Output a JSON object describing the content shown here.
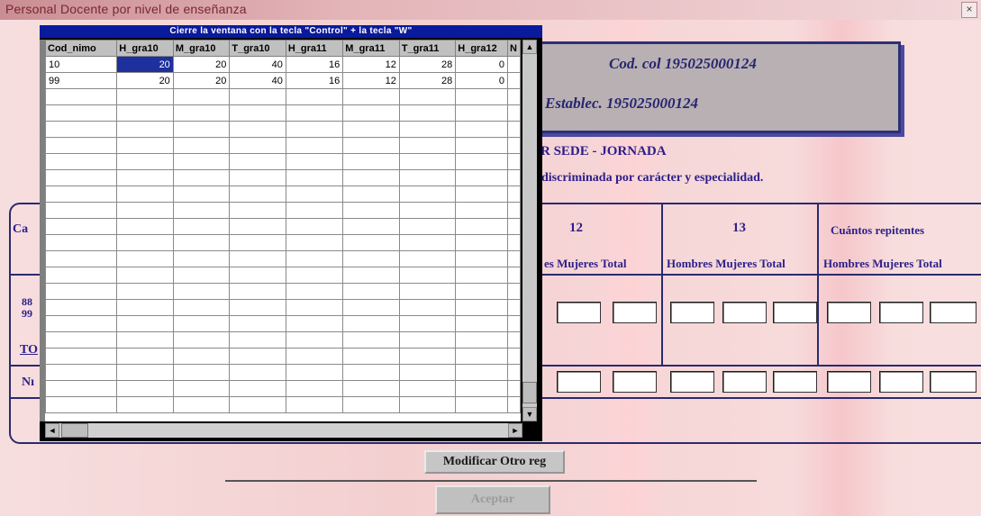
{
  "window": {
    "title": "Personal Docente por nivel de enseñanza",
    "close_glyph": "×"
  },
  "info": {
    "cod_col": "Cod. col 195025000124",
    "establec": "Establec.  195025000124"
  },
  "section": {
    "sede_heading": "R SEDE - JORNADA",
    "discriminada": "discriminada por carácter y especialidad."
  },
  "table": {
    "left_header_partial": "Ca",
    "left_rows_partial": [
      "88",
      "99"
    ],
    "total_partial": "TO",
    "num_partial": "Nı",
    "groups": [
      {
        "title": "12",
        "sub": "es  Mujeres Total"
      },
      {
        "title": "13",
        "sub": "Hombres Mujeres Total"
      },
      {
        "title": "Cuántos repitentes",
        "sub": "Hombres Mujeres Total"
      }
    ]
  },
  "datasheet": {
    "title": "Cierre la ventana con la tecla \"Control\" + la tecla \"W\"",
    "columns": [
      "Cod_nimo",
      "H_gra10",
      "M_gra10",
      "T_gra10",
      "H_gra11",
      "M_gra11",
      "T_gra11",
      "H_gra12",
      "N"
    ],
    "rows": [
      [
        "10",
        "20",
        "20",
        "40",
        "16",
        "12",
        "28",
        "0"
      ],
      [
        "99",
        "20",
        "20",
        "40",
        "16",
        "12",
        "28",
        "0"
      ]
    ],
    "selected_cell": {
      "row": 0,
      "col": 1
    },
    "empty_row_count": 20,
    "scroll_up_icon": "▲",
    "scroll_down_icon": "▼",
    "scroll_left_icon": "◄",
    "scroll_right_icon": "►"
  },
  "buttons": {
    "modify": "Modificar Otro reg",
    "accept": "Aceptar"
  }
}
